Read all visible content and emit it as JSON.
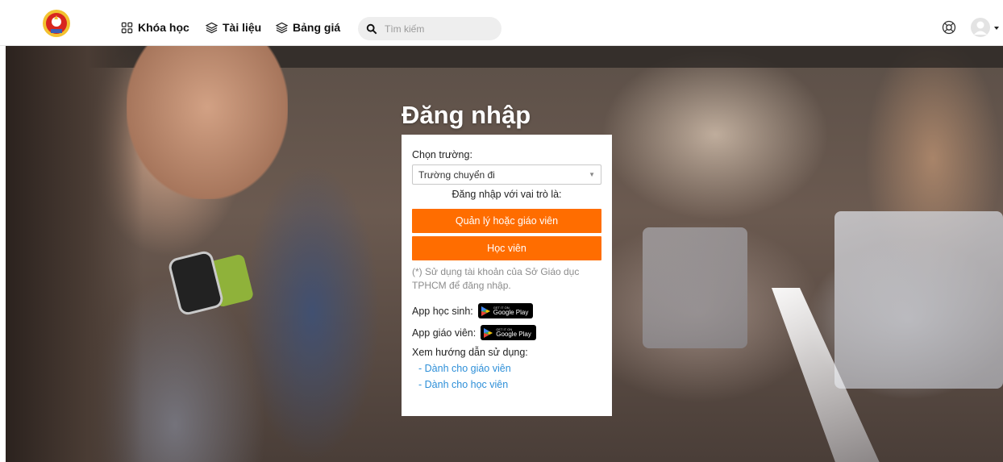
{
  "nav": {
    "courses_label": "Khóa học",
    "docs_label": "Tài liệu",
    "pricing_label": "Bảng giá",
    "search_placeholder": "Tìm kiếm"
  },
  "login": {
    "title": "Đăng nhập",
    "school_label": "Chọn trường:",
    "school_selected": "Trường chuyển đi",
    "role_prompt": "Đăng nhập với vai trò là:",
    "manager_button": "Quản lý hoặc giáo viên",
    "student_button": "Học viên",
    "note": "(*) Sử dụng tài khoản của Sở Giáo dục TPHCM để đăng nhập.",
    "student_app_label": "App học sinh:",
    "teacher_app_label": "App giáo viên:",
    "guide_label": "Xem hướng dẫn sử dụng:",
    "guide_teacher": "- Dành cho giáo viên",
    "guide_student": "- Dành cho học viên"
  },
  "badges": {
    "small_text": "GET IT ON",
    "big_text": "Google Play"
  },
  "colors": {
    "accent": "#ff6d00",
    "link": "#2d8fd8"
  },
  "icons": {
    "courses": "grid-icon",
    "docs": "layers-icon",
    "pricing": "layers-icon",
    "search": "search-icon",
    "help": "lifebuoy-icon",
    "user": "user-avatar-icon"
  }
}
